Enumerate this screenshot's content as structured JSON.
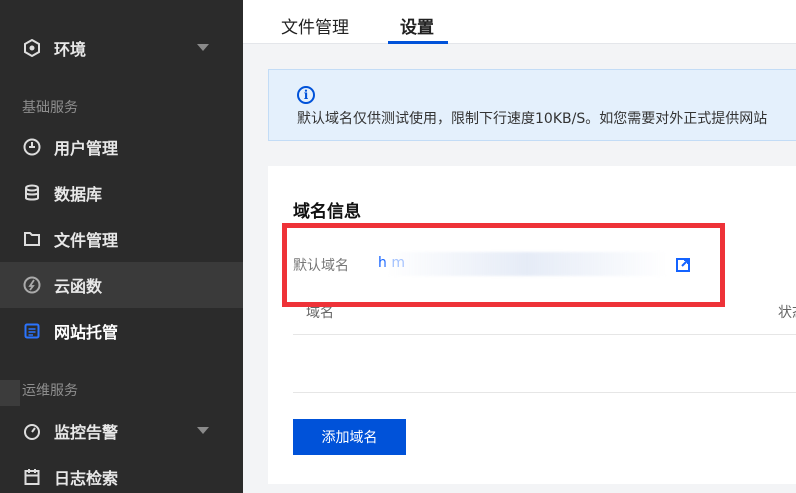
{
  "sidebar": {
    "env_label": "环境",
    "group_basic": "基础服务",
    "group_ops": "运维服务",
    "items": [
      {
        "label": "用户管理",
        "icon": "user-management-icon"
      },
      {
        "label": "数据库",
        "icon": "database-icon"
      },
      {
        "label": "文件管理",
        "icon": "folder-icon"
      },
      {
        "label": "云函数",
        "icon": "cloud-function-icon"
      },
      {
        "label": "网站托管",
        "icon": "website-hosting-icon"
      },
      {
        "label": "监控告警",
        "icon": "monitor-icon"
      },
      {
        "label": "日志检索",
        "icon": "log-search-icon"
      }
    ]
  },
  "tabs": [
    {
      "label": "文件管理"
    },
    {
      "label": "设置"
    }
  ],
  "alert": {
    "text": "默认域名仅供测试使用，限制下行速度10KB/S。如您需要对外正式提供网站"
  },
  "domain_card": {
    "title": "域名信息",
    "default_domain_label": "默认域名",
    "default_domain_value": "h      m",
    "table_headers": [
      "域名",
      "状态"
    ],
    "add_button": "添加域名"
  },
  "colors": {
    "accent": "#0052d9",
    "link": "#1463ff",
    "highlight": "#ee3238",
    "sidebar_bg": "#2b2b2b"
  }
}
